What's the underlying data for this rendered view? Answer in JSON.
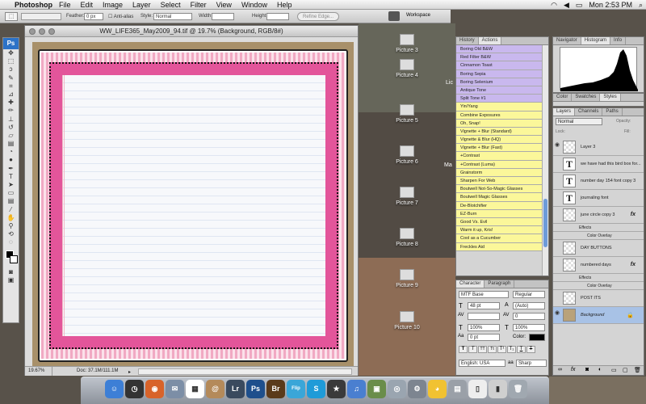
{
  "menubar": {
    "app": "Photoshop",
    "items": [
      "File",
      "Edit",
      "Image",
      "Layer",
      "Select",
      "Filter",
      "View",
      "Window",
      "Help"
    ],
    "time": "Mon 2:53 PM"
  },
  "options": {
    "feather_label": "Feather:",
    "feather_value": "0 px",
    "antialias": "Anti-alias",
    "style_label": "Style:",
    "style_value": "Normal",
    "width_label": "Width:",
    "height_label": "Height:",
    "refine_edge": "Refine Edge...",
    "workspace": "Workspace"
  },
  "document": {
    "title": "WW_LIFE365_May2009_94.tif @ 19.7% (Background, RGB/8#)",
    "zoom": "19.67%",
    "doc_size": "Doc: 37.1M/111.1M"
  },
  "desktop": {
    "icons": [
      "Picture 3",
      "Picture 4",
      "Picture 5",
      "Picture 6",
      "Picture 7",
      "Picture 8",
      "Picture 9",
      "Picture 10"
    ],
    "partial_left": "Lic",
    "partial_right": "Ma"
  },
  "actions": {
    "tabs": [
      "History",
      "Actions"
    ],
    "items": [
      {
        "label": "Boring Old B&W",
        "color": "purple"
      },
      {
        "label": "Red Filter B&W",
        "color": "purple"
      },
      {
        "label": "Cinnamon Toast",
        "color": "purple"
      },
      {
        "label": "Boring Sepia",
        "color": "purple"
      },
      {
        "label": "Boring Selenium",
        "color": "purple"
      },
      {
        "label": "Antique Tone",
        "color": "purple"
      },
      {
        "label": "Split Tone #1",
        "color": "purple"
      },
      {
        "label": "Yin/Yang",
        "color": "yellow"
      },
      {
        "label": "Combine Exposures",
        "color": "yellow"
      },
      {
        "label": "Oh, Snap!",
        "color": "yellow"
      },
      {
        "label": "Vignette + Blur (Standard)",
        "color": "yellow"
      },
      {
        "label": "Vignette & Blur (HQ)",
        "color": "yellow"
      },
      {
        "label": "Vignette + Blur (Fast)",
        "color": "yellow"
      },
      {
        "label": "+Contrast",
        "color": "yellow"
      },
      {
        "label": "+Contrast (Luma)",
        "color": "yellow"
      },
      {
        "label": "Grainstorm",
        "color": "yellow"
      },
      {
        "label": "Sharpen For Web",
        "color": "yellow"
      },
      {
        "label": "Boutwell Not-So-Magic Glasses",
        "color": "yellow"
      },
      {
        "label": "Boutwell Magic Glasses",
        "color": "yellow"
      },
      {
        "label": "De-Blotchifier",
        "color": "yellow"
      },
      {
        "label": "EZ-Burn",
        "color": "yellow"
      },
      {
        "label": "Good Vs. Evil",
        "color": "yellow"
      },
      {
        "label": "Warm it up, Kris!",
        "color": "yellow"
      },
      {
        "label": "Cool as a Cucumber",
        "color": "yellow"
      },
      {
        "label": "Freckles Aid",
        "color": "yellow"
      }
    ]
  },
  "character": {
    "tabs": [
      "Character",
      "Paragraph"
    ],
    "font": "MTF Base",
    "style": "Regular",
    "size": "48 pt",
    "leading": "(Auto)",
    "kerning": "0",
    "scale_v": "100%",
    "scale_h": "100%",
    "baseline": "0 pt",
    "color_label": "Color:",
    "lang": "English: USA",
    "aa": "Sharp",
    "aa_label": "aa"
  },
  "histogram": {
    "tabs": [
      "Navigator",
      "Histogram",
      "Info"
    ]
  },
  "styles": {
    "tabs": [
      "Color",
      "Swatches",
      "Styles"
    ]
  },
  "layers": {
    "tabs": [
      "Layers",
      "Channels",
      "Paths"
    ],
    "mode": "Normal",
    "opacity_label": "Opacity:",
    "lock_label": "Lock:",
    "fill_label": "Fill:",
    "rows": [
      {
        "name": "Layer 3",
        "kind": "pixel"
      },
      {
        "name": "we have had this bird box for...",
        "kind": "text"
      },
      {
        "name": "number day 154 font copy 3",
        "kind": "text"
      },
      {
        "name": "journaling font",
        "kind": "text"
      },
      {
        "name": "june circle copy 3",
        "kind": "pixel",
        "fx": "fx"
      },
      {
        "name": "Effects",
        "kind": "sub"
      },
      {
        "name": "Color Overlay",
        "kind": "sub"
      },
      {
        "name": "DAY BUTTONS",
        "kind": "pixel"
      },
      {
        "name": "numbered days",
        "kind": "pixel",
        "fx": "fx"
      },
      {
        "name": "Effects",
        "kind": "sub"
      },
      {
        "name": "Color Overlay",
        "kind": "sub"
      },
      {
        "name": "POST ITS",
        "kind": "pixel"
      },
      {
        "name": "Background",
        "kind": "bg"
      }
    ]
  },
  "dock": {
    "items": [
      {
        "name": "finder-icon",
        "color": "#3d7fd6",
        "glyph": "☺"
      },
      {
        "name": "dashboard-icon",
        "color": "#333333",
        "glyph": "◷"
      },
      {
        "name": "firefox-icon",
        "color": "#d8632a",
        "glyph": "◉"
      },
      {
        "name": "mail-icon",
        "color": "#7c8ea6",
        "glyph": "✉"
      },
      {
        "name": "ical-icon",
        "color": "#ffffff",
        "glyph": "▦"
      },
      {
        "name": "address-book-icon",
        "color": "#b48a5a",
        "glyph": "@"
      },
      {
        "name": "lightroom-icon",
        "color": "#3a4a5e",
        "glyph": "Lr"
      },
      {
        "name": "photoshop-icon",
        "color": "#1e4f8c",
        "glyph": "Ps"
      },
      {
        "name": "bridge-icon",
        "color": "#5a3a1a",
        "glyph": "Br"
      },
      {
        "name": "flip4mac-icon",
        "color": "#3aa6d8",
        "glyph": "Flip"
      },
      {
        "name": "skype-icon",
        "color": "#1f9bd8",
        "glyph": "S"
      },
      {
        "name": "imovie-icon",
        "color": "#3a3a3a",
        "glyph": "★"
      },
      {
        "name": "itunes-icon",
        "color": "#4a7fd0",
        "glyph": "♫"
      },
      {
        "name": "iphoto-icon",
        "color": "#6a8d4a",
        "glyph": "▣"
      },
      {
        "name": "preview-icon",
        "color": "#9aa5b0",
        "glyph": "◎"
      },
      {
        "name": "system-preferences-icon",
        "color": "#7d8590",
        "glyph": "⚙"
      },
      {
        "name": "adium-icon",
        "color": "#f1c232",
        "glyph": "◕"
      },
      {
        "name": "cyberduck-icon",
        "color": "#9aa0a8",
        "glyph": "▤"
      },
      {
        "name": "document-icon",
        "color": "#eeeeee",
        "glyph": "▯"
      },
      {
        "name": "downloads-stack-icon",
        "color": "#cfcfcf",
        "glyph": "▮"
      },
      {
        "name": "trash-icon",
        "color": "#a0a8b0",
        "glyph": "🗑"
      }
    ]
  }
}
